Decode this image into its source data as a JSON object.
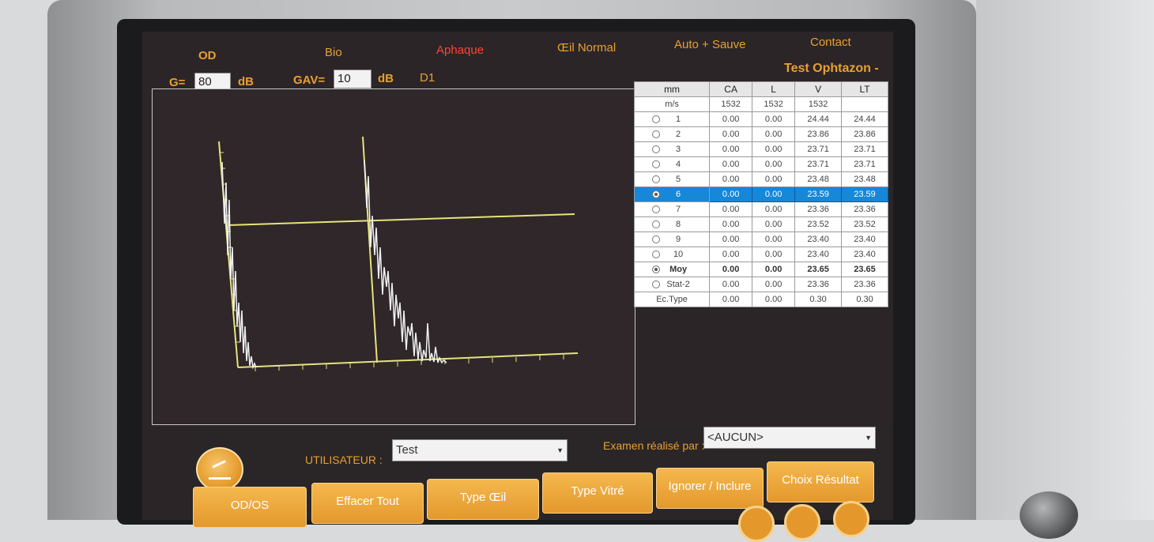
{
  "menu": {
    "items": [
      {
        "label": "OD"
      },
      {
        "label": "Bio"
      },
      {
        "label": "Aphaque"
      },
      {
        "label": "Œil Normal"
      },
      {
        "label": "Auto + Sauve"
      },
      {
        "label": "Contact"
      }
    ]
  },
  "params": {
    "gain_label": "G=",
    "gain_value": "80",
    "gain_unit": "dB",
    "gav_label": "GAV=",
    "gav_value": "10",
    "gav_unit": "dB",
    "mode": "D1",
    "device_name": "Test Ophtazon -"
  },
  "table": {
    "headers": [
      "mm",
      "CA",
      "L",
      "V",
      "LT"
    ],
    "speed": {
      "label": "m/s",
      "ca": "1532",
      "l": "1532",
      "v": "1532",
      "lt": ""
    },
    "rows": [
      {
        "n": "1",
        "ca": "0.00",
        "l": "0.00",
        "v": "24.44",
        "lt": "24.44"
      },
      {
        "n": "2",
        "ca": "0.00",
        "l": "0.00",
        "v": "23.86",
        "lt": "23.86"
      },
      {
        "n": "3",
        "ca": "0.00",
        "l": "0.00",
        "v": "23.71",
        "lt": "23.71"
      },
      {
        "n": "4",
        "ca": "0.00",
        "l": "0.00",
        "v": "23.71",
        "lt": "23.71"
      },
      {
        "n": "5",
        "ca": "0.00",
        "l": "0.00",
        "v": "23.48",
        "lt": "23.48"
      },
      {
        "n": "6",
        "ca": "0.00",
        "l": "0.00",
        "v": "23.59",
        "lt": "23.59"
      },
      {
        "n": "7",
        "ca": "0.00",
        "l": "0.00",
        "v": "23.36",
        "lt": "23.36"
      },
      {
        "n": "8",
        "ca": "0.00",
        "l": "0.00",
        "v": "23.52",
        "lt": "23.52"
      },
      {
        "n": "9",
        "ca": "0.00",
        "l": "0.00",
        "v": "23.40",
        "lt": "23.40"
      },
      {
        "n": "10",
        "ca": "0.00",
        "l": "0.00",
        "v": "23.40",
        "lt": "23.40"
      }
    ],
    "summary": [
      {
        "label": "Moy",
        "ca": "0.00",
        "l": "0.00",
        "v": "23.65",
        "lt": "23.65"
      },
      {
        "label": "Stat-2",
        "ca": "0.00",
        "l": "0.00",
        "v": "23.36",
        "lt": "23.36"
      },
      {
        "label": "Ec.Type",
        "ca": "0.00",
        "l": "0.00",
        "v": "0.30",
        "lt": "0.30"
      }
    ]
  },
  "footer": {
    "user_label": "UTILISATEUR :",
    "user_value": "Test",
    "exam_label": "Examen réalisé par :",
    "exam_value": "<AUCUN>"
  },
  "buttons": {
    "odos": "OD/OS",
    "clear_all": "Effacer Tout",
    "eye_type": "Type Œil",
    "vitreous_type": "Type Vitré",
    "ignore_include": "Ignorer / Inclure",
    "choose_result": "Choix Résultat"
  }
}
